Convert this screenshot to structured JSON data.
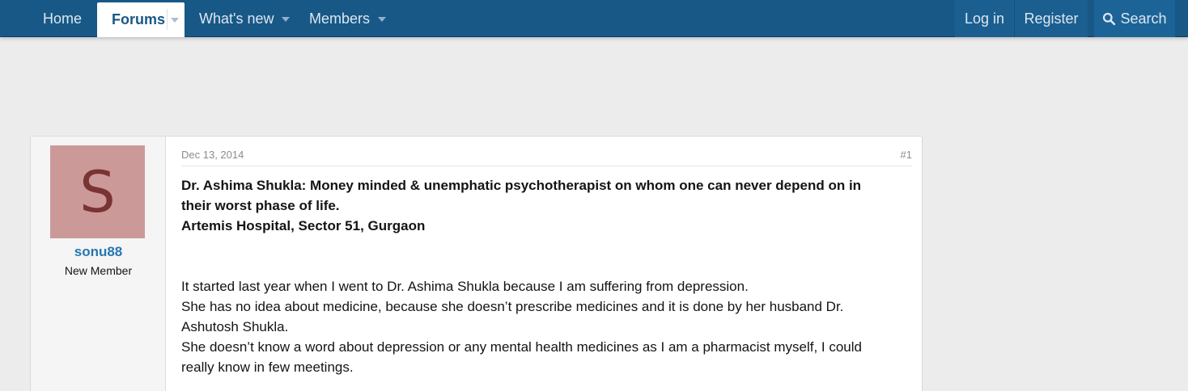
{
  "nav": {
    "home": "Home",
    "forums": "Forums",
    "whats_new": "What's new",
    "members": "Members",
    "login": "Log in",
    "register": "Register",
    "search": "Search"
  },
  "post": {
    "date": "Dec 13, 2014",
    "number": "#1",
    "author": {
      "avatar_letter": "S",
      "username": "sonu88",
      "title": "New Member"
    },
    "title_lines": [
      "Dr. Ashima Shukla: Money minded & unemphatic psychotherapist on whom one can never depend on in",
      "their worst phase of life.",
      "Artemis Hospital, Sector 51, Gurgaon"
    ],
    "body_lines": [
      "It started last year when I went to Dr. Ashima Shukla because I am suffering from depression.",
      "She has no idea about medicine, because she doesn’t prescribe medicines and it is done by her husband Dr.",
      "Ashutosh Shukla.",
      "She doesn’t know a word about depression or any mental health medicines as I am a pharmacist myself, I could",
      "really know in few meetings."
    ]
  },
  "colors": {
    "nav_bg": "#185886",
    "link": "#2577b1",
    "avatar_bg": "#cc9999",
    "avatar_text": "#7a3333"
  }
}
